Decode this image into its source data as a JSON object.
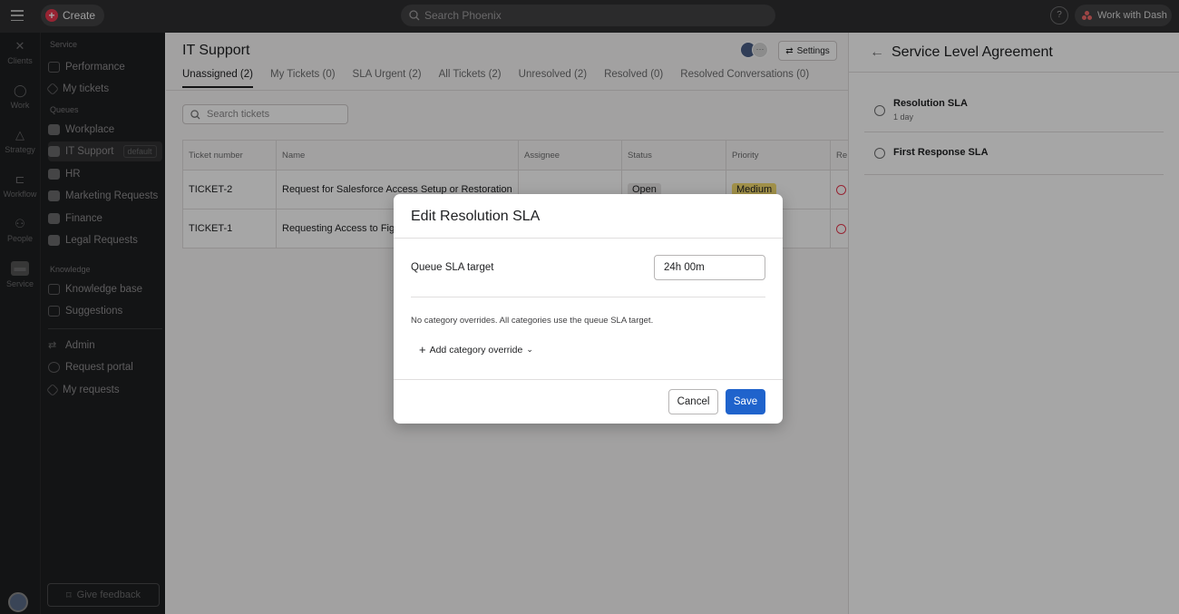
{
  "topbar": {
    "create_label": "Create",
    "search_placeholder": "Search Phoenix",
    "help_label": "?",
    "work_with_dash_label": "Work with Dash"
  },
  "rail": {
    "items": [
      {
        "label": "Clients",
        "icon": "clients-icon"
      },
      {
        "label": "Work",
        "icon": "check-circle-icon"
      },
      {
        "label": "Strategy",
        "icon": "triangle-icon"
      },
      {
        "label": "Workflow",
        "icon": "workflow-icon"
      },
      {
        "label": "People",
        "icon": "people-icon"
      },
      {
        "label": "Service",
        "icon": "service-icon"
      }
    ]
  },
  "sidebar": {
    "service_label": "Service",
    "service_items": [
      "Performance",
      "My tickets"
    ],
    "queues_label": "Queues",
    "queue_items": [
      "Workplace",
      "IT Support",
      "HR",
      "Marketing Requests",
      "Finance",
      "Legal Requests"
    ],
    "default_badge": "default",
    "knowledge_label": "Knowledge",
    "knowledge_items": [
      "Knowledge base",
      "Suggestions"
    ],
    "other_items": [
      "Admin",
      "Request portal",
      "My requests"
    ],
    "feedback_label": "Give feedback"
  },
  "main": {
    "title": "IT Support",
    "settings_label": "Settings",
    "tabs": [
      "Unassigned (2)",
      "My Tickets (0)",
      "SLA Urgent (2)",
      "All Tickets (2)",
      "Unresolved (2)",
      "Resolved (0)",
      "Resolved Conversations (0)"
    ],
    "search_placeholder": "Search tickets",
    "table": {
      "headers": [
        "Ticket number",
        "Name",
        "Assignee",
        "Status",
        "Priority",
        "Re"
      ],
      "rows": [
        {
          "ticket": "TICKET-2",
          "name": "Request for Salesforce Access Setup or Restoration",
          "assignee": "",
          "status": "Open",
          "priority": "Medium"
        },
        {
          "ticket": "TICKET-1",
          "name": "Requesting Access to Figma",
          "assignee": "",
          "status": "",
          "priority": ""
        }
      ]
    }
  },
  "right_panel": {
    "title": "Service Level Agreement",
    "items": [
      {
        "name": "Resolution SLA",
        "sub": "1 day"
      },
      {
        "name": "First Response SLA",
        "sub": ""
      }
    ]
  },
  "modal": {
    "title": "Edit Resolution SLA",
    "target_label": "Queue SLA target",
    "target_value": "24h 00m",
    "no_overrides_text": "No category overrides. All categories use the queue SLA target.",
    "add_override_label": "Add category override",
    "cancel_label": "Cancel",
    "save_label": "Save"
  },
  "colors": {
    "accent": "#1f63cc",
    "create": "#e8384f",
    "priority_medium": "#f8df72"
  }
}
